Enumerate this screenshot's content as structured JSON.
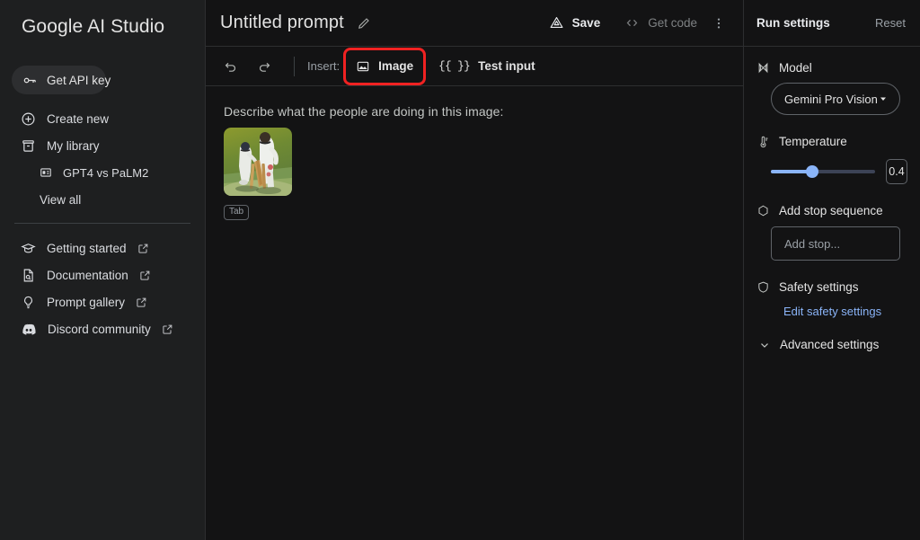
{
  "sidebar": {
    "brand": "Google AI Studio",
    "api_key_button": {
      "label": "Get API key",
      "icon": "key-icon"
    },
    "items": [
      {
        "label": "Create new",
        "icon": "plus-circle-icon"
      },
      {
        "label": "My library",
        "icon": "library-icon"
      }
    ],
    "library_entry": {
      "label": "GPT4 vs PaLM2",
      "icon": "prompt-file-icon"
    },
    "view_all": "View all",
    "links": [
      {
        "label": "Getting started",
        "icon": "graduation-cap-icon",
        "external": true
      },
      {
        "label": "Documentation",
        "icon": "document-search-icon",
        "external": true
      },
      {
        "label": "Prompt gallery",
        "icon": "lightbulb-icon",
        "external": true
      },
      {
        "label": "Discord community",
        "icon": "discord-icon",
        "external": true
      }
    ]
  },
  "header": {
    "title": "Untitled prompt",
    "edit_icon": "pencil-icon",
    "save_label": "Save",
    "save_icon": "drive-icon",
    "get_code_label": "Get code",
    "get_code_icon": "code-brackets-icon",
    "menu_icon": "more-vertical-icon"
  },
  "toolbar": {
    "undo_icon": "undo-icon",
    "redo_icon": "redo-icon",
    "insert_label": "Insert:",
    "image_label": "Image",
    "image_icon": "image-icon",
    "test_input_label": "Test input",
    "test_input_icon": "{{ }}",
    "highlight_color": "#f02222"
  },
  "editor": {
    "prompt_text": "Describe what the people are doing in this image:",
    "attachment": {
      "name": "cricket-image-thumbnail",
      "chip_label": "Tab"
    }
  },
  "run_settings": {
    "title": "Run settings",
    "reset_label": "Reset",
    "model": {
      "label": "Model",
      "icon": "model-atom-icon",
      "selected": "Gemini Pro Vision",
      "caret_icon": "chevron-down-icon",
      "options": [
        "Gemini Pro Vision"
      ]
    },
    "temperature": {
      "label": "Temperature",
      "icon": "thermometer-icon",
      "value": "0.4",
      "percent": 40
    },
    "stop_sequence": {
      "label": "Add stop sequence",
      "icon": "hexagon-icon",
      "placeholder": "Add stop..."
    },
    "safety": {
      "label": "Safety settings",
      "icon": "shield-icon",
      "link_label": "Edit safety settings",
      "link_color": "#8ab4f8"
    },
    "advanced": {
      "label": "Advanced settings",
      "icon": "chevron-down-icon"
    }
  },
  "colors": {
    "sidebar_bg": "#1e1f20",
    "main_bg": "#131314",
    "border": "#2d2e30",
    "accent": "#8ab4f8",
    "text": "#e3e3e3",
    "muted": "#9aa0a6"
  }
}
